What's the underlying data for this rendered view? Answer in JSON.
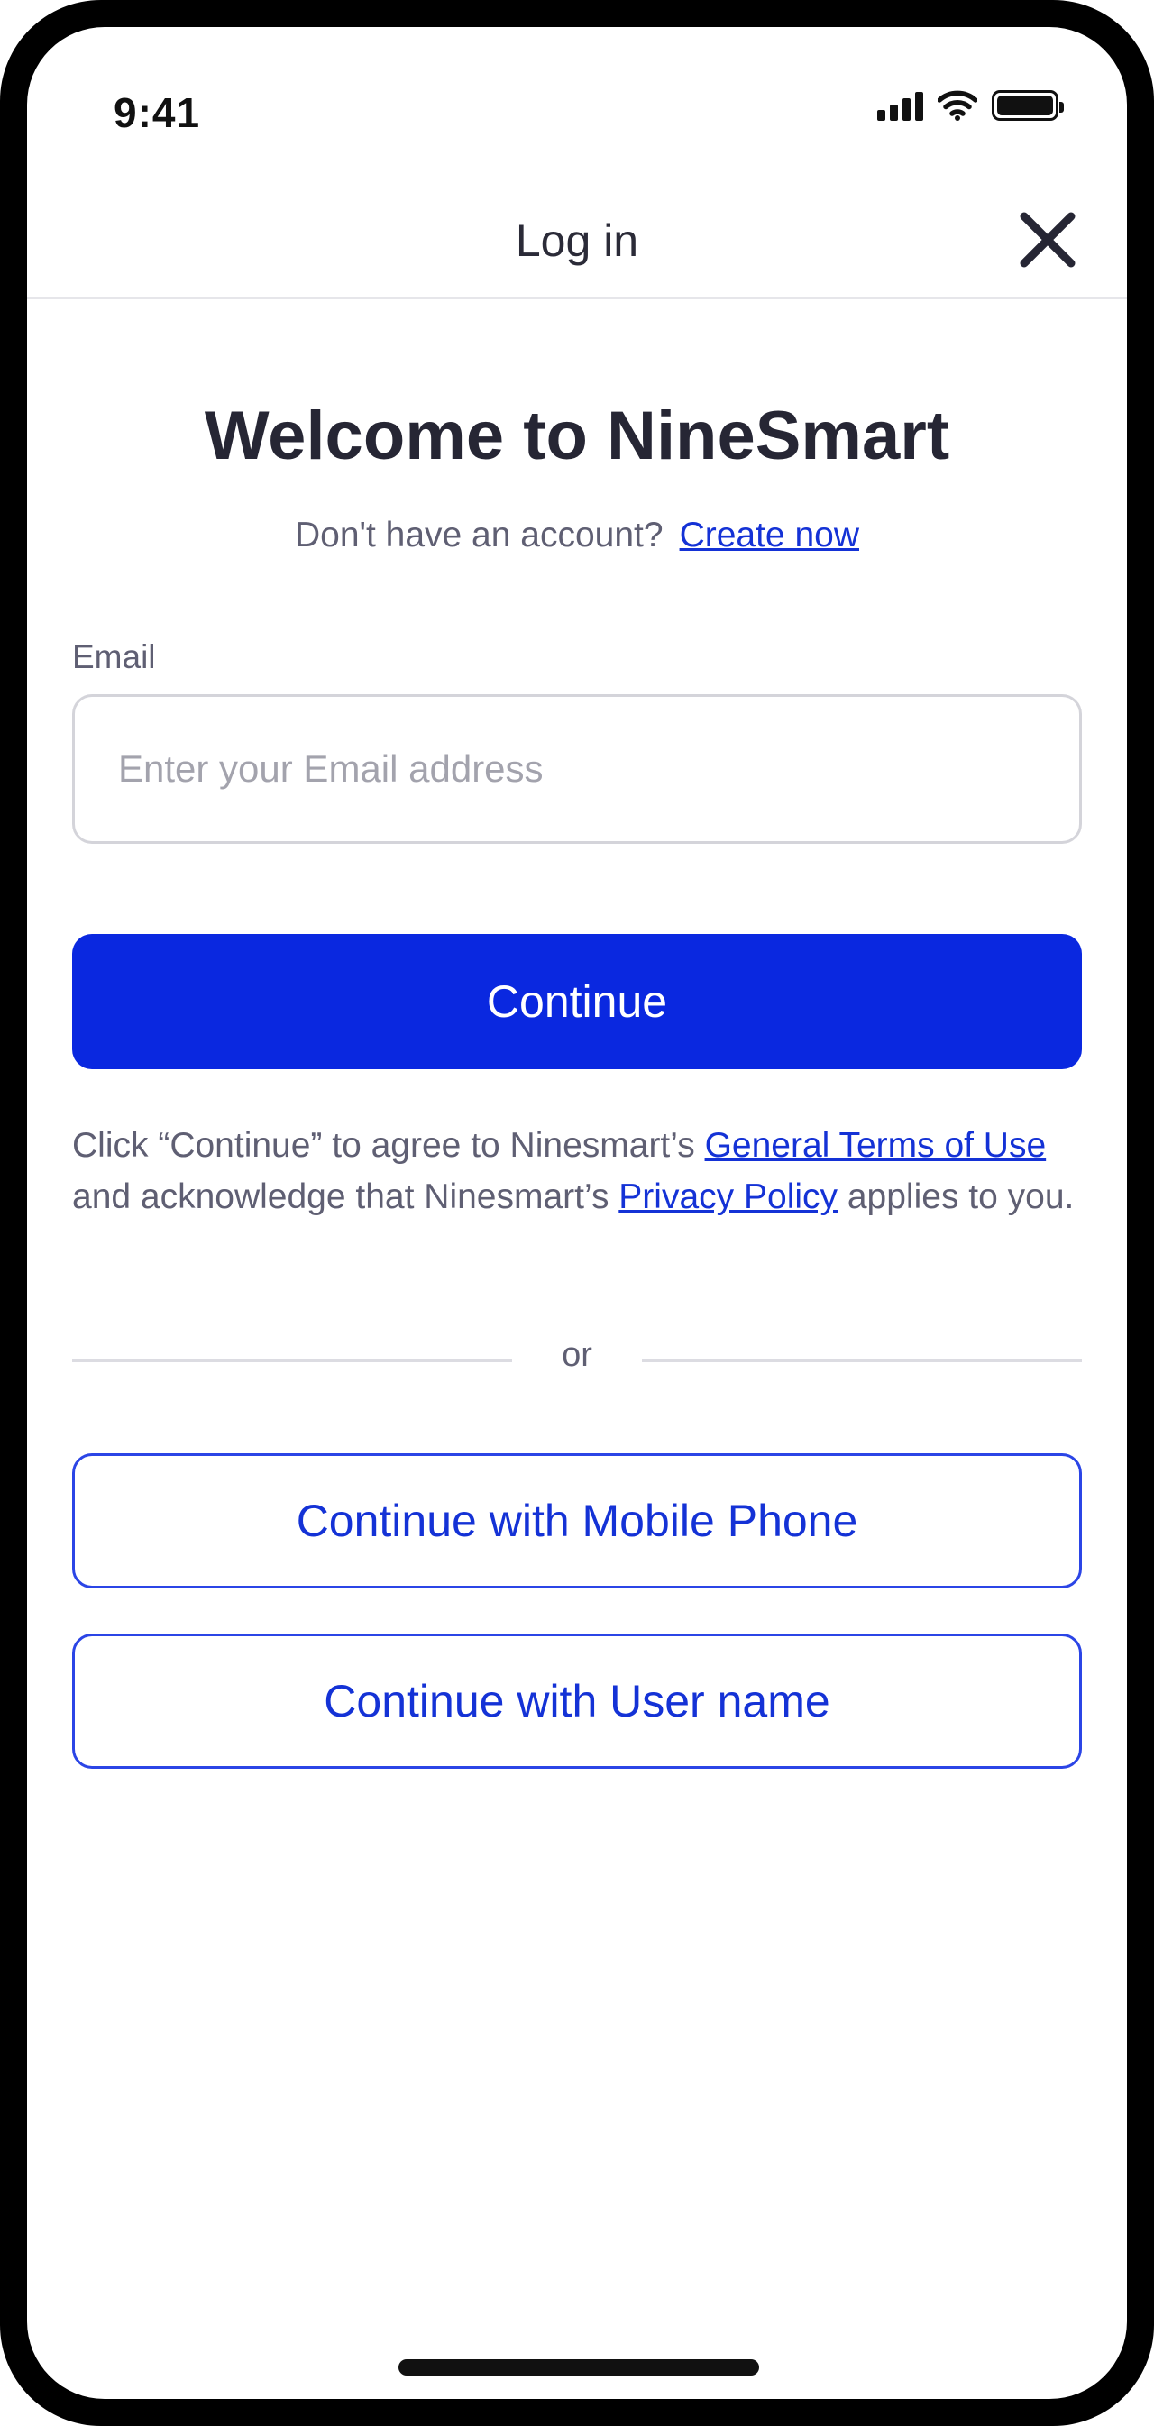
{
  "status_bar": {
    "time": "9:41",
    "icons": [
      "cellular-signal-icon",
      "wifi-icon",
      "battery-icon"
    ]
  },
  "header": {
    "title": "Log in",
    "close_icon": "close-icon"
  },
  "main": {
    "welcome_title": "Welcome to NineSmart",
    "no_account_text": "Don't have an account?",
    "create_link": "Create now",
    "email": {
      "label": "Email",
      "placeholder": "Enter your Email address",
      "value": ""
    },
    "continue_button": "Continue",
    "terms": {
      "prefix": "Click “Continue” to agree to Ninesmart’s ",
      "terms_link": "General Terms of Use",
      "middle": " and acknowledge that Ninesmart’s ",
      "privacy_link": "Privacy Policy",
      "suffix": " applies to you."
    },
    "divider_text": "or",
    "mobile_button": "Continue with Mobile Phone",
    "username_button": "Continue with User name"
  },
  "colors": {
    "primary": "#0a28e0",
    "link": "#1432d6",
    "text_dark": "#262634",
    "text_muted": "#5f5f73"
  }
}
